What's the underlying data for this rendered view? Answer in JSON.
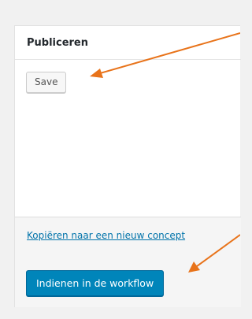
{
  "publish_box": {
    "title": "Publiceren",
    "save_label": "Save",
    "copy_link": "Kopiëren naar een nieuw concept",
    "submit_label": "Indienen in de workflow"
  },
  "colors": {
    "page_background": "#f1f1f1",
    "panel_background": "#ffffff",
    "footer_background": "#f5f5f5",
    "primary_button": "#0085ba",
    "link": "#0073aa",
    "annotation_arrow": "#e8731a"
  }
}
